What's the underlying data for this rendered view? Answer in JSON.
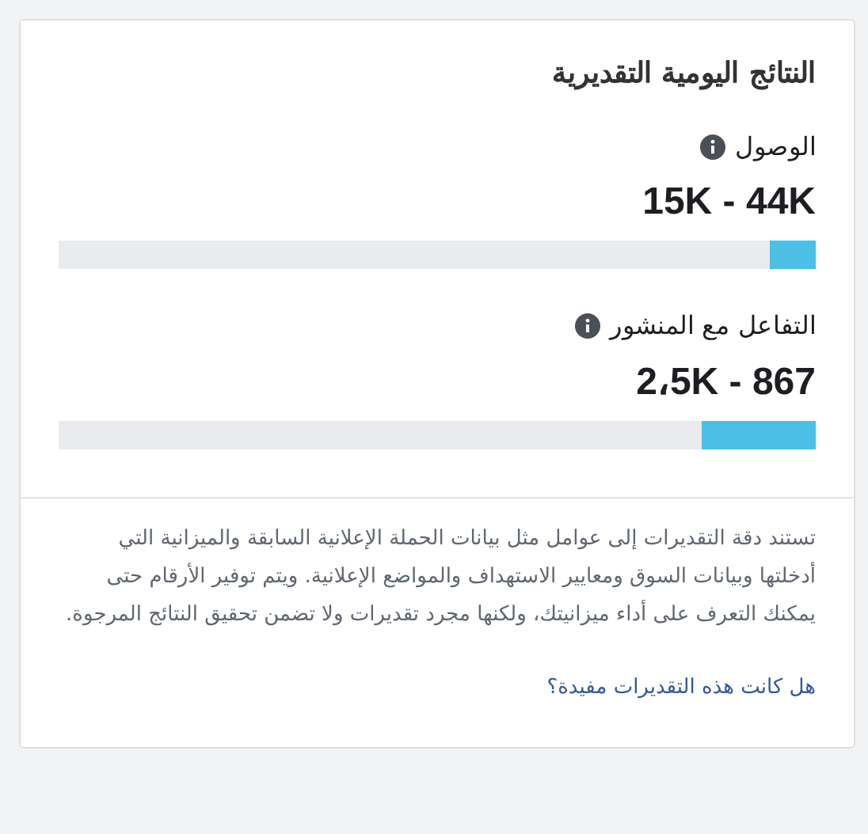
{
  "card": {
    "title": "النتائج اليومية التقديرية"
  },
  "metrics": [
    {
      "label": "الوصول",
      "range": "15K - 44K",
      "level": 0.06
    },
    {
      "label": "التفاعل مع المنشور",
      "range": "2،5K - 867",
      "level": 0.15
    }
  ],
  "note": "تستند دقة التقديرات إلى عوامل مثل بيانات الحملة الإعلانية السابقة والميزانية التي أدخلتها وبيانات السوق ومعايير الاستهداف والمواضع الإعلانية. ويتم توفير الأرقام حتى يمكنك التعرف على أداء ميزانيتك، ولكنها مجرد تقديرات ولا تضمن تحقيق النتائج المرجوة.",
  "feedback_link": "هل كانت هذه التقديرات مفيدة؟"
}
